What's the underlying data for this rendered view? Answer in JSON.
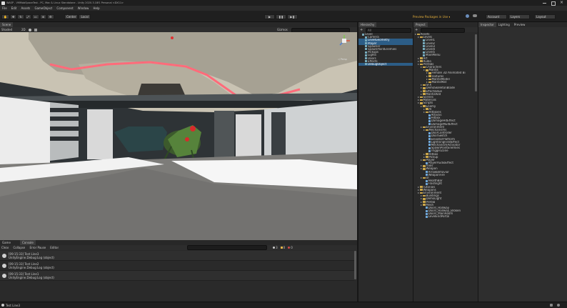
{
  "window": {
    "title": "WASP - VMMobSpaceTest - PC, Mac & Linux Standalone - Unity 2020.3.18f1 Personal <DX11>",
    "menu": [
      "File",
      "Edit",
      "Assets",
      "GameObject",
      "Component",
      "Window",
      "Help"
    ]
  },
  "toolbar": {
    "center_label": "Center",
    "local_label": "Local",
    "play_icon": "play-icon",
    "pause_icon": "pause-icon",
    "step_icon": "step-icon",
    "notice": "Preview Packages in Use ▾",
    "account_label": "Account",
    "layers_label": "Layers",
    "layout_label": "Layout"
  },
  "scene": {
    "tab_label": "Scene",
    "shading": "Shaded",
    "mode_2d": "2D",
    "gizmos_label": "Gizmos",
    "persp_label": "◁ Persp"
  },
  "console": {
    "tabs": [
      "Game",
      "Console"
    ],
    "toolbar": [
      "Clear",
      "Collapse",
      "Error Pause",
      "Editor"
    ],
    "counts": [
      "3",
      "0",
      "0"
    ],
    "entries": [
      {
        "line1": "[09:15:33] Test Line3",
        "line2": "UnityEngine.Debug:Log (object)"
      },
      {
        "line1": "[09:15:33] Test Line2",
        "line2": "UnityEngine.Debug:Log (object)"
      },
      {
        "line1": "[09:15:33] Test Line1",
        "line2": "UnityEngine.Debug:Log (object)"
      }
    ]
  },
  "hierarchy": {
    "tab_label": "Hierarchy",
    "search_label": "All",
    "items": [
      {
        "label": "Level",
        "depth": 0,
        "icon": "cube",
        "selected": false
      },
      {
        "label": "Camera",
        "depth": 1,
        "icon": "cube",
        "selected": false
      },
      {
        "label": "LevelGeometry",
        "depth": 1,
        "icon": "cube",
        "selected": true
      },
      {
        "label": "Player",
        "depth": 1,
        "icon": "cube",
        "selected": true
      },
      {
        "label": "Spawner",
        "depth": 1,
        "icon": "cube",
        "selected": false
      },
      {
        "label": "SpawnPointEnemies",
        "depth": 1,
        "icon": "cube",
        "selected": false
      },
      {
        "label": "Pickups",
        "depth": 1,
        "icon": "cube",
        "selected": false
      },
      {
        "label": "Lights",
        "depth": 1,
        "icon": "cube",
        "selected": false
      },
      {
        "label": "Doors",
        "depth": 1,
        "icon": "cube",
        "selected": false
      },
      {
        "label": "Effects",
        "depth": 1,
        "icon": "cube",
        "selected": false
      },
      {
        "label": "DebugObject",
        "depth": 1,
        "icon": "cube",
        "selected": true
      }
    ]
  },
  "project": {
    "tab_label": "Project",
    "items": [
      {
        "label": "Assets",
        "depth": 0,
        "icon": "folder"
      },
      {
        "label": "Levels",
        "depth": 1,
        "icon": "folder"
      },
      {
        "label": "Level1",
        "depth": 2,
        "icon": "cube"
      },
      {
        "label": "Level2",
        "depth": 2,
        "icon": "cube"
      },
      {
        "label": "Level3",
        "depth": 2,
        "icon": "cube"
      },
      {
        "label": "Level4",
        "depth": 2,
        "icon": "cube"
      },
      {
        "label": "Level5",
        "depth": 2,
        "icon": "cube"
      },
      {
        "label": "MainMenu",
        "depth": 2,
        "icon": "cube"
      },
      {
        "label": "Art",
        "depth": 1,
        "icon": "folder"
      },
      {
        "label": "Audio",
        "depth": 1,
        "icon": "folder"
      },
      {
        "label": "Prefabs",
        "depth": 1,
        "icon": "folder"
      },
      {
        "label": "Characters",
        "depth": 2,
        "icon": "folder"
      },
      {
        "label": "Mantis",
        "depth": 3,
        "icon": "folder"
      },
      {
        "label": "Female 3D Animated Bi",
        "depth": 4,
        "icon": "folder"
      },
      {
        "label": "Textures",
        "depth": 4,
        "icon": "folder"
      },
      {
        "label": "MantisModel",
        "depth": 4,
        "icon": "folder"
      },
      {
        "label": "MantisMat",
        "depth": 4,
        "icon": "folder"
      },
      {
        "label": "SFX",
        "depth": 2,
        "icon": "folder"
      },
      {
        "label": "DemoSkeletonBlade",
        "depth": 2,
        "icon": "folder"
      },
      {
        "label": "EffectsBlue",
        "depth": 2,
        "icon": "folder"
      },
      {
        "label": "MantisRed",
        "depth": 2,
        "icon": "folder"
      },
      {
        "label": "Scenes",
        "depth": 1,
        "icon": "folder"
      },
      {
        "label": "Materials",
        "depth": 1,
        "icon": "folder"
      },
      {
        "label": "Scripts",
        "depth": 1,
        "icon": "folder"
      },
      {
        "label": "Enemy",
        "depth": 2,
        "icon": "folder"
      },
      {
        "label": "AI",
        "depth": 3,
        "icon": "folder"
      },
      {
        "label": "Hitboxes",
        "depth": 3,
        "icon": "folder"
      },
      {
        "label": "Attacks",
        "depth": 4,
        "icon": "script"
      },
      {
        "label": "Hitbox",
        "depth": 4,
        "icon": "script"
      },
      {
        "label": "DamageHitEffect",
        "depth": 4,
        "icon": "script"
      },
      {
        "label": "DamageMultEffect",
        "depth": 4,
        "icon": "script"
      },
      {
        "label": "Environment",
        "depth": 2,
        "icon": "folder"
      },
      {
        "label": "Mechanisms",
        "depth": 3,
        "icon": "folder"
      },
      {
        "label": "DoorController",
        "depth": 4,
        "icon": "script"
      },
      {
        "label": "DoorSwitch",
        "depth": 4,
        "icon": "script"
      },
      {
        "label": "ElevatorPlatform",
        "depth": 4,
        "icon": "script"
      },
      {
        "label": "LightningFieldEffect",
        "depth": 4,
        "icon": "script"
      },
      {
        "label": "MechanismActivator",
        "depth": 4,
        "icon": "script"
      },
      {
        "label": "SpawnPointEnemies",
        "depth": 4,
        "icon": "script"
      },
      {
        "label": "TriggerZone",
        "depth": 4,
        "icon": "script"
      },
      {
        "label": "Hitbox",
        "depth": 3,
        "icon": "folder"
      },
      {
        "label": "Pickup",
        "depth": 3,
        "icon": "folder"
      },
      {
        "label": "Player",
        "depth": 2,
        "icon": "folder"
      },
      {
        "label": "PlayerAudioEffect",
        "depth": 3,
        "icon": "script"
      },
      {
        "label": "Tools",
        "depth": 2,
        "icon": "folder"
      },
      {
        "label": "Weapon",
        "depth": 2,
        "icon": "folder"
      },
      {
        "label": "ArrowBehavior",
        "depth": 3,
        "icon": "script"
      },
      {
        "label": "WeaponFire",
        "depth": 3,
        "icon": "script"
      },
      {
        "label": "UI",
        "depth": 2,
        "icon": "folder"
      },
      {
        "label": "HealthBar",
        "depth": 3,
        "icon": "script"
      },
      {
        "label": "Flashlight",
        "depth": 3,
        "icon": "script"
      },
      {
        "label": "Tutorials",
        "depth": 1,
        "icon": "folder"
      },
      {
        "label": "Weapons",
        "depth": 1,
        "icon": "folder"
      },
      {
        "label": "Environment",
        "depth": 1,
        "icon": "folder"
      },
      {
        "label": "Buildings",
        "depth": 2,
        "icon": "folder"
      },
      {
        "label": "DemoLight",
        "depth": 2,
        "icon": "folder"
      },
      {
        "label": "Prefab",
        "depth": 2,
        "icon": "folder"
      },
      {
        "label": "Mesh",
        "depth": 2,
        "icon": "folder"
      },
      {
        "label": "Doors_Hallway",
        "depth": 3,
        "icon": "script"
      },
      {
        "label": "Doors_Hallway_Broken",
        "depth": 3,
        "icon": "script"
      },
      {
        "label": "Doors_MainRoom",
        "depth": 3,
        "icon": "script"
      },
      {
        "label": "LevelEndPortal",
        "depth": 3,
        "icon": "script"
      }
    ]
  },
  "inspector": {
    "tabs": [
      "Inspector",
      "Lighting",
      "Preview"
    ]
  },
  "status": {
    "text": "Test Line3"
  }
}
